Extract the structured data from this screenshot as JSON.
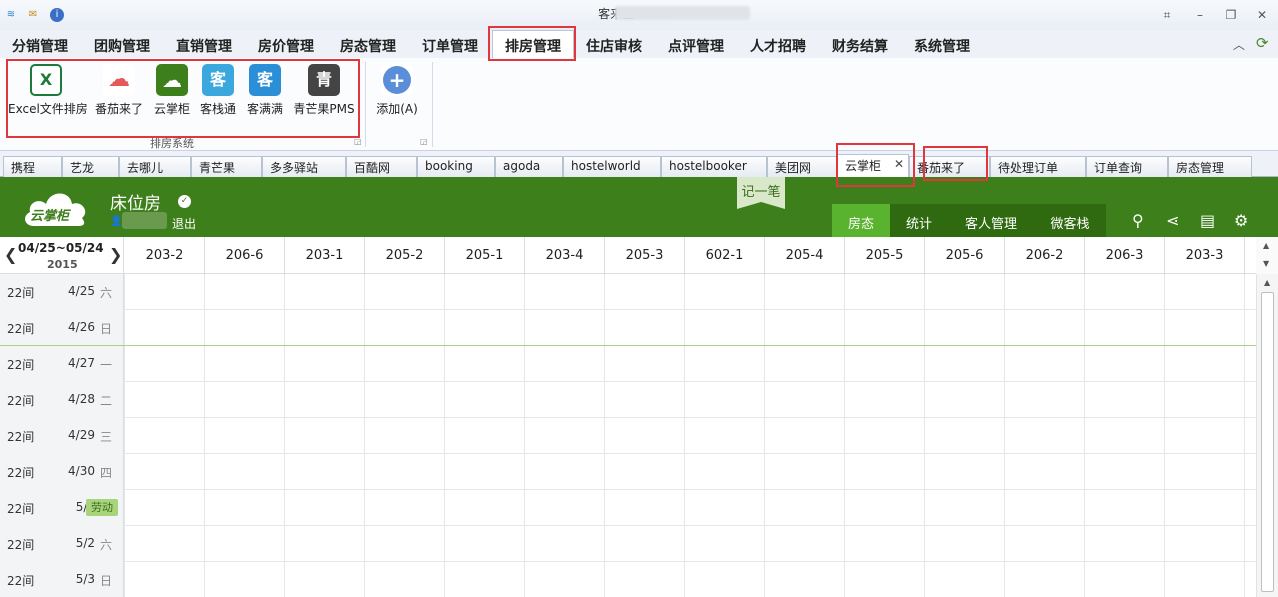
{
  "window": {
    "title": "客来宝v1.2.1 -",
    "icons": [
      "wifi-icon",
      "mail-icon",
      "info-icon"
    ],
    "controls": [
      "restore-icon",
      "minimize-icon",
      "maximize-icon",
      "close-icon"
    ]
  },
  "menu": {
    "items": [
      "分销管理",
      "团购管理",
      "直销管理",
      "房价管理",
      "房态管理",
      "订单管理",
      "排房管理",
      "住店审核",
      "点评管理",
      "人才招聘",
      "财务结算",
      "系统管理"
    ],
    "active": "排房管理"
  },
  "ribbon": {
    "buttons": [
      {
        "label": "Excel文件排房",
        "icon": "excel-icon",
        "glyph": "X",
        "color": "#1e7a3a"
      },
      {
        "label": "番茄来了",
        "icon": "tomato-cloud-icon",
        "glyph": "☁",
        "color": "#e45a5a"
      },
      {
        "label": "云掌柜",
        "icon": "yunzhanggui-icon",
        "glyph": "☁",
        "color": "#3d7f1b"
      },
      {
        "label": "客栈通",
        "icon": "kezhantong-icon",
        "glyph": "客",
        "color": "#3aa8dc"
      },
      {
        "label": "客满满",
        "icon": "kemanman-icon",
        "glyph": "客",
        "color": "#2b8fd8"
      },
      {
        "label": "青芒果PMS",
        "icon": "qingmangguo-icon",
        "glyph": "青",
        "color": "#444"
      }
    ],
    "group_label": "排房系统",
    "add_label": "添加(A)"
  },
  "channel_tabs": {
    "items": [
      "携程",
      "艺龙",
      "去哪儿",
      "青芒果",
      "多多驿站",
      "百酷网",
      "booking",
      "agoda",
      "hostelworld",
      "hostelbooker",
      "美团网",
      "云掌柜",
      "番茄来了",
      "待处理订单",
      "订单查询",
      "房态管理"
    ],
    "active": "云掌柜",
    "close_glyph": "✕"
  },
  "app_header": {
    "logo_text": "云掌柜",
    "hotel_name": "床位房",
    "logout": "退出",
    "note_button": "记一笔",
    "tabs": [
      "房态",
      "统计",
      "客人管理",
      "微客栈"
    ],
    "active_tab": "房态",
    "tool_icons": [
      "search-icon",
      "share-icon",
      "notebook-icon",
      "settings-icon"
    ]
  },
  "calendar": {
    "range": "04/25~05/24",
    "year": "2015",
    "prev_glyph": "❮",
    "next_glyph": "❯",
    "rooms": [
      "203-2",
      "206-6",
      "203-1",
      "205-2",
      "205-1",
      "203-4",
      "205-3",
      "602-1",
      "205-4",
      "205-5",
      "205-6",
      "206-2",
      "206-3",
      "203-3"
    ],
    "rows": [
      {
        "count": "22间",
        "date": "4/25",
        "weekday": "六"
      },
      {
        "count": "22间",
        "date": "4/26",
        "weekday": "日"
      },
      {
        "count": "22间",
        "date": "4/27",
        "weekday": "一"
      },
      {
        "count": "22间",
        "date": "4/28",
        "weekday": "二"
      },
      {
        "count": "22间",
        "date": "4/29",
        "weekday": "三"
      },
      {
        "count": "22间",
        "date": "4/30",
        "weekday": "四"
      },
      {
        "count": "22间",
        "date": "5/1",
        "weekday": "",
        "holiday": "劳动"
      },
      {
        "count": "22间",
        "date": "5/2",
        "weekday": "六"
      },
      {
        "count": "22间",
        "date": "5/3",
        "weekday": "日"
      }
    ]
  },
  "colors": {
    "header_green": "#3d7f1b",
    "active_tab_green": "#5ab32e",
    "highlight_red": "#e0363d"
  }
}
